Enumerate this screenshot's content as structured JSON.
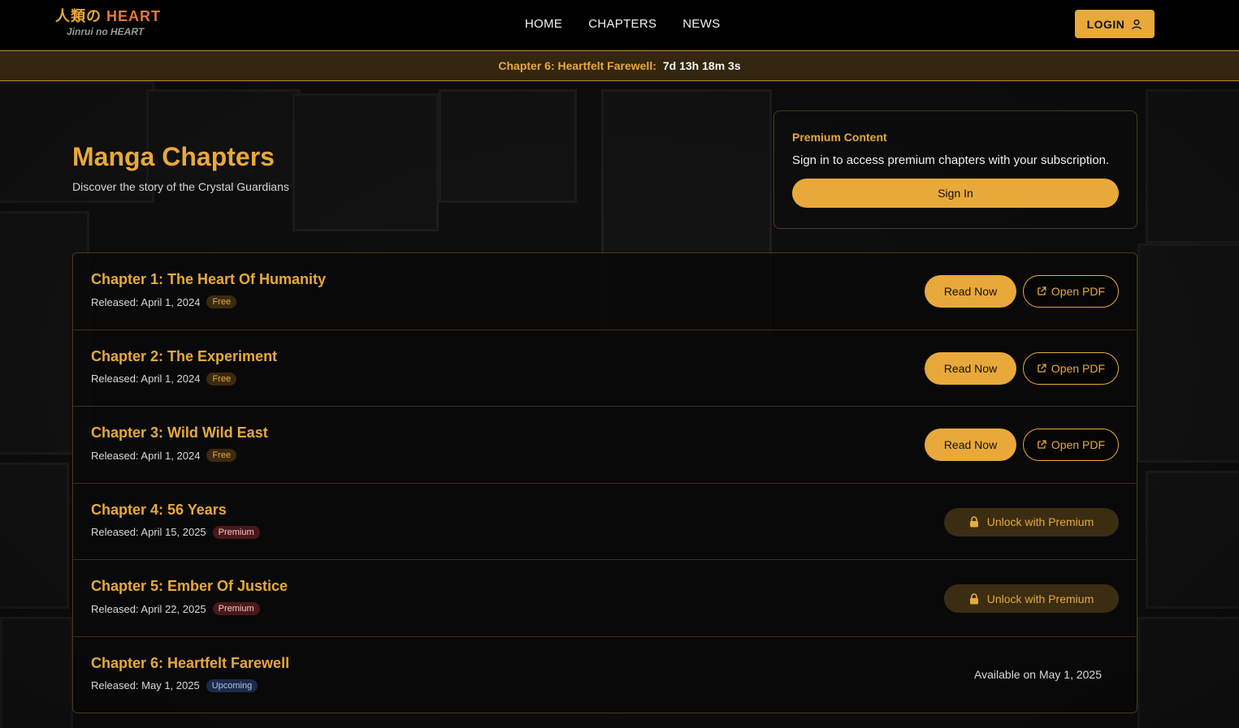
{
  "brand": {
    "kanji": "人類の",
    "name": "HEART",
    "subtitle": "Jinrui no HEART"
  },
  "nav": {
    "items": [
      {
        "label": "HOME"
      },
      {
        "label": "CHAPTERS"
      },
      {
        "label": "NEWS"
      }
    ],
    "login_label": "LOGIN"
  },
  "countdown": {
    "title": "Chapter 6: Heartfelt Farewell:",
    "time": "7d 13h 18m 3s"
  },
  "hero": {
    "title": "Manga Chapters",
    "subtitle": "Discover the story of the Crystal Guardians"
  },
  "premium": {
    "title": "Premium Content",
    "text": "Sign in to access premium chapters with your subscription.",
    "button": "Sign In"
  },
  "chapters": [
    {
      "title": "Chapter 1: The Heart Of Humanity",
      "released": "Released: April 1, 2024",
      "badge": "Free",
      "read_label": "Read Now",
      "pdf_label": "Open PDF"
    },
    {
      "title": "Chapter 2: The Experiment",
      "released": "Released: April 1, 2024",
      "badge": "Free",
      "read_label": "Read Now",
      "pdf_label": "Open PDF"
    },
    {
      "title": "Chapter 3: Wild Wild East",
      "released": "Released: April 1, 2024",
      "badge": "Free",
      "read_label": "Read Now",
      "pdf_label": "Open PDF"
    },
    {
      "title": "Chapter 4: 56 Years",
      "released": "Released: April 15, 2025",
      "badge": "Premium",
      "unlock_label": "Unlock with Premium"
    },
    {
      "title": "Chapter 5: Ember Of Justice",
      "released": "Released: April 22, 2025",
      "badge": "Premium",
      "unlock_label": "Unlock with Premium"
    },
    {
      "title": "Chapter 6: Heartfelt Farewell",
      "released": "Released: May 1, 2025",
      "badge": "Upcoming",
      "available_label": "Available on May 1, 2025"
    }
  ],
  "colors": {
    "accent": "#e8a93a",
    "background": "#0b0b0b",
    "premium_badge": "#4a1818",
    "upcoming_badge": "#1d2a48"
  }
}
